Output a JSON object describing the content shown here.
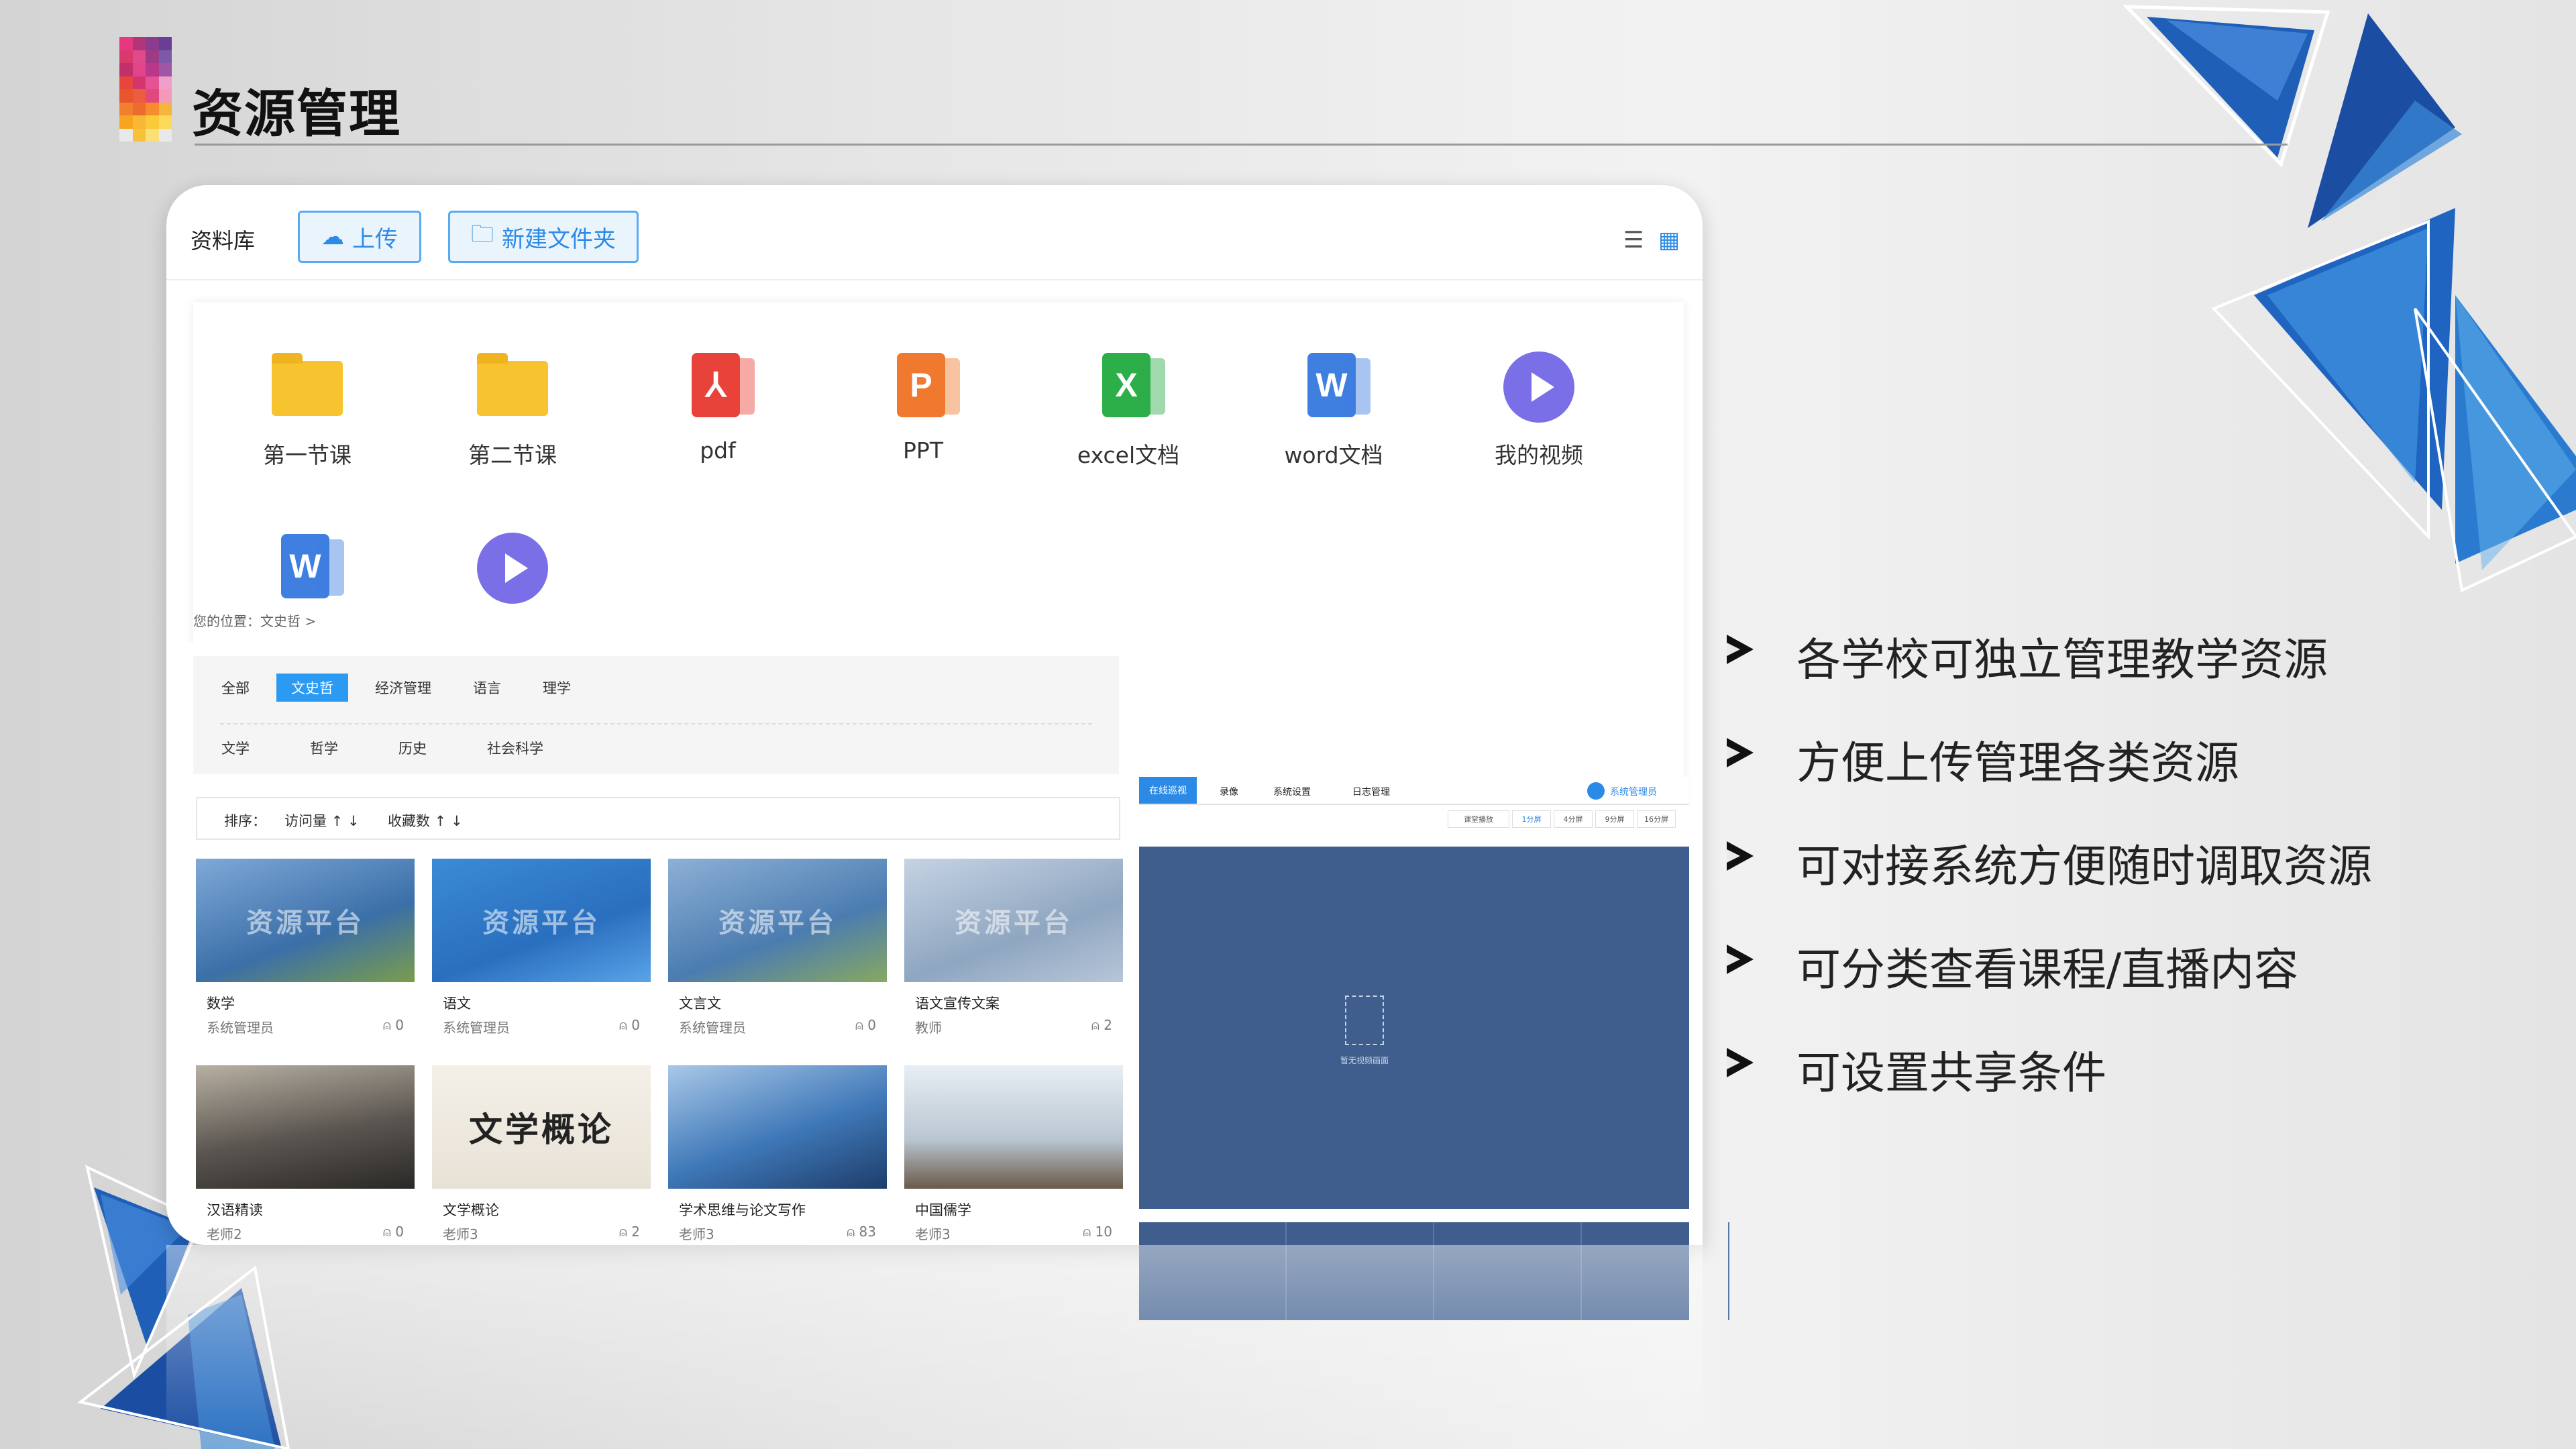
{
  "header": {
    "title": "资源管理"
  },
  "toolbar": {
    "library_label": "资料库",
    "upload_label": "上传",
    "new_folder_label": "新建文件夹"
  },
  "files": [
    {
      "label": "第一节课",
      "icon": "folder-icon"
    },
    {
      "label": "第二节课",
      "icon": "folder-icon"
    },
    {
      "label": "pdf",
      "icon": "pdf-icon"
    },
    {
      "label": "PPT",
      "icon": "ppt-icon"
    },
    {
      "label": "excel文档",
      "icon": "excel-icon"
    },
    {
      "label": "word文档",
      "icon": "word-icon"
    },
    {
      "label": "我的视频",
      "icon": "video-play-icon"
    }
  ],
  "breadcrumb": "您的位置：文史哲 >",
  "filters": {
    "row1": [
      "全部",
      "文史哲",
      "经济管理",
      "语言",
      "理学"
    ],
    "row1_active": "文史哲",
    "row2": [
      "文学",
      "哲学",
      "历史",
      "社会科学"
    ]
  },
  "sort": {
    "label": "排序：",
    "by_visits": "访问量 ↑ ↓",
    "by_favorites": "收藏数 ↑ ↓"
  },
  "courses": [
    {
      "name": "数学",
      "author": "系统管理员",
      "count": "0",
      "thumb_text": "资源平台"
    },
    {
      "name": "语文",
      "author": "系统管理员",
      "count": "0",
      "thumb_text": "资源平台"
    },
    {
      "name": "文言文",
      "author": "系统管理员",
      "count": "0",
      "thumb_text": "资源平台"
    },
    {
      "name": "语文宣传文案",
      "author": "教师",
      "count": "2",
      "thumb_text": "资源平台"
    },
    {
      "name": "汉语精读",
      "author": "老师2",
      "count": "0",
      "thumb_text": ""
    },
    {
      "name": "文学概论",
      "author": "老师3",
      "count": "2",
      "thumb_text": "文学概论"
    },
    {
      "name": "学术思维与论文写作",
      "author": "老师3",
      "count": "83",
      "thumb_text": ""
    },
    {
      "name": "中国儒学",
      "author": "老师3",
      "count": "10",
      "thumb_text": ""
    }
  ],
  "live": {
    "tabs": [
      "在线巡视",
      "录像",
      "系统设置",
      "日志管理"
    ],
    "user": "系统管理员",
    "segments": [
      "课堂播放",
      "1分屏",
      "4分屏",
      "9分屏",
      "16分屏"
    ],
    "no_video": "暂无视频画面"
  },
  "bullets": [
    "各学校可独立管理教学资源",
    "方便上传管理各类资源",
    "可对接系统方便随时调取资源",
    "可分类查看课程/直播内容",
    "可设置共享条件"
  ],
  "colors": {
    "accent": "#2b9af3",
    "triangle_blue": "#2255aa",
    "live_bg": "#3f5e8e"
  }
}
